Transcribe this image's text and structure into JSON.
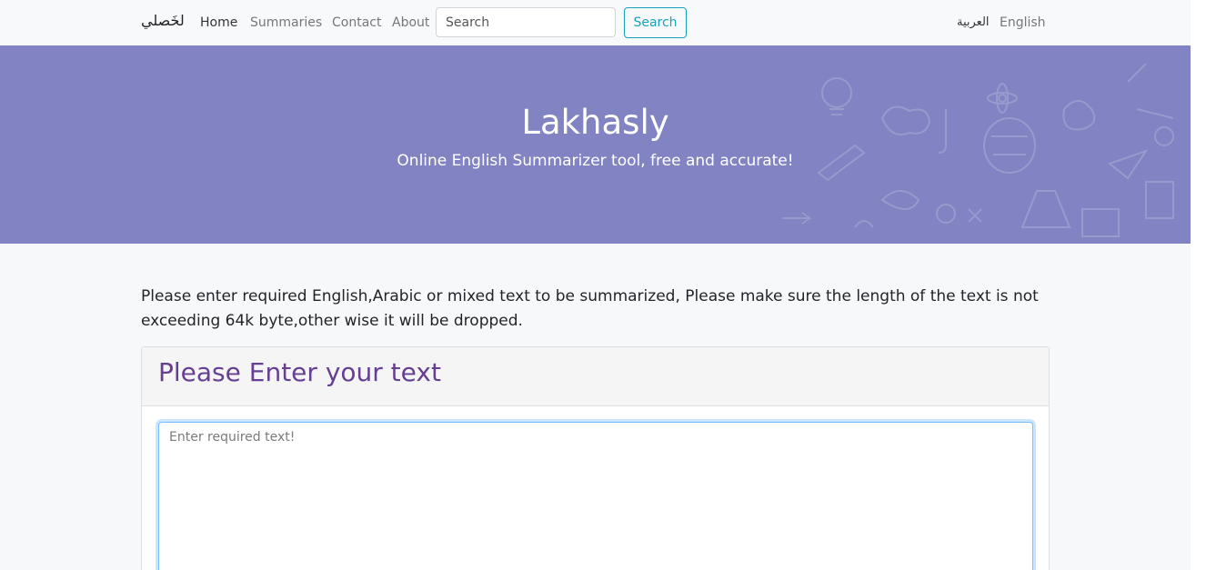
{
  "navbar": {
    "brand": "لخَصلي",
    "links": [
      "Home",
      "Summaries",
      "Contact",
      "About"
    ],
    "search": {
      "placeholder": "Search",
      "button_label": "Search"
    },
    "languages": [
      "العربية",
      "English"
    ]
  },
  "hero": {
    "title": "Lakhasly",
    "subtitle": "Online English Summarizer tool, free and accurate!",
    "background_color": "#8183c2"
  },
  "main": {
    "intro": "Please enter required English,Arabic or mixed text to be summarized, Please make sure the length of the text is not exceeding 64k byte,other wise it will be dropped.",
    "card": {
      "title": "Please Enter your text",
      "textarea_placeholder": "Enter required text!",
      "title_color": "#663f93"
    }
  },
  "colors": {
    "accent": "#17a2b8",
    "focus_border": "#80bdff"
  }
}
